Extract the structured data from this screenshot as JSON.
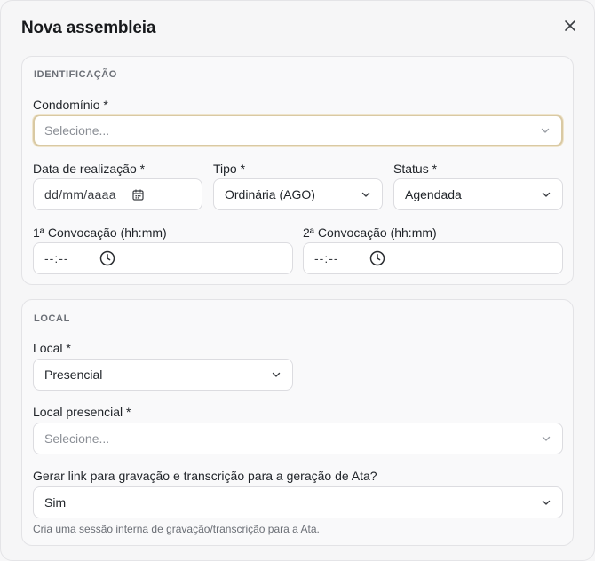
{
  "modal": {
    "title": "Nova assembleia"
  },
  "identificacao": {
    "title": "IDENTIFICAÇÃO",
    "condominio": {
      "label": "Condomínio *",
      "placeholder": "Selecione..."
    },
    "data_realizacao": {
      "label": "Data de realização *",
      "placeholder": "dd/mm/aaaa"
    },
    "tipo": {
      "label": "Tipo *",
      "value": "Ordinária (AGO)"
    },
    "status": {
      "label": "Status *",
      "value": "Agendada"
    },
    "convocacao1": {
      "label": "1ª Convocação (hh:mm)",
      "placeholder": "--:--"
    },
    "convocacao2": {
      "label": "2ª Convocação (hh:mm)",
      "placeholder": "--:--"
    }
  },
  "local": {
    "title": "LOCAL",
    "local": {
      "label": "Local *",
      "value": "Presencial"
    },
    "local_presencial": {
      "label": "Local presencial *",
      "placeholder": "Selecione..."
    },
    "gerar_link": {
      "label": "Gerar link para gravação e transcrição para a geração de Ata?",
      "value": "Sim",
      "helper": "Cria uma sessão interna de gravação/transcrição para a Ata."
    }
  },
  "icons": {
    "close": "close-icon",
    "chevron": "chevron-down-icon",
    "calendar": "calendar-icon",
    "clock": "clock-icon"
  }
}
